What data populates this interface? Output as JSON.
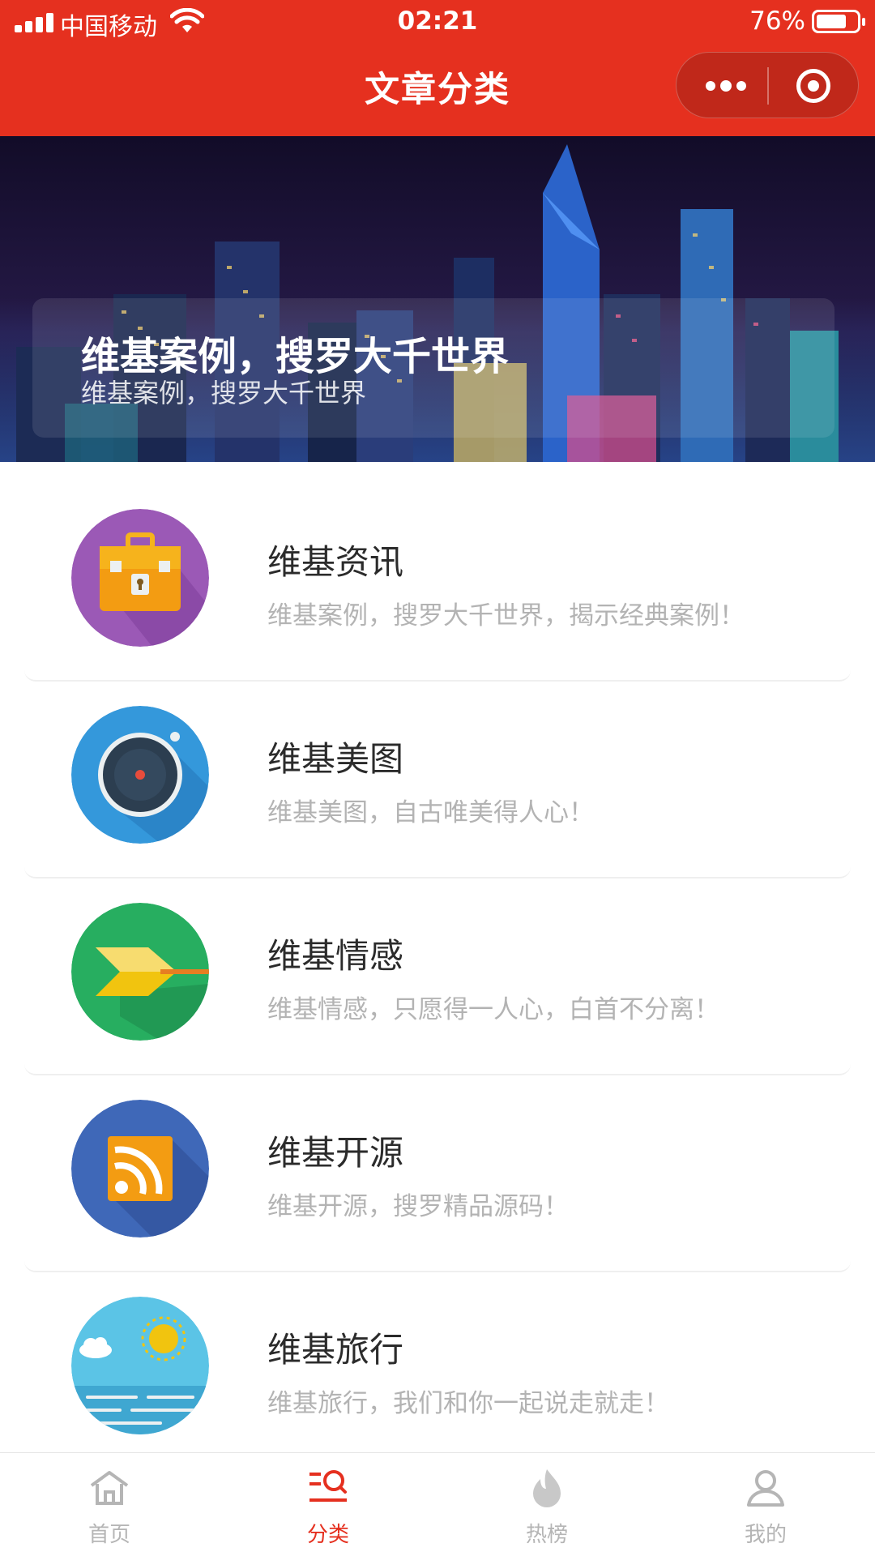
{
  "status_bar": {
    "carrier": "中国移动",
    "time": "02:21",
    "battery_percent": "76%",
    "battery_level": 0.76
  },
  "nav": {
    "title": "文章分类"
  },
  "banner": {
    "title": "维基案例，搜罗大千世界",
    "subtitle": "维基案例，搜罗大千世界"
  },
  "categories": [
    {
      "title": "维基资讯",
      "desc": "维基案例，搜罗大千世界，揭示经典案例！",
      "icon": "briefcase-icon",
      "color": "#9b59b6"
    },
    {
      "title": "维基美图",
      "desc": "维基美图，自古唯美得人心！",
      "icon": "camera-lens-icon",
      "color": "#3498db"
    },
    {
      "title": "维基情感",
      "desc": "维基情感，只愿得一人心，白首不分离！",
      "icon": "arrow-icon",
      "color": "#27ae60"
    },
    {
      "title": "维基开源",
      "desc": "维基开源，搜罗精品源码！",
      "icon": "rss-icon",
      "color": "#3f68b8"
    },
    {
      "title": "维基旅行",
      "desc": "维基旅行，我们和你一起说走就走！",
      "icon": "sun-sea-icon",
      "color": "#5bc4e6"
    }
  ],
  "tabbar": {
    "items": [
      {
        "label": "首页",
        "icon": "home-icon"
      },
      {
        "label": "分类",
        "icon": "category-icon",
        "active": true
      },
      {
        "label": "热榜",
        "icon": "flame-icon"
      },
      {
        "label": "我的",
        "icon": "user-icon"
      }
    ]
  },
  "colors": {
    "brand": "#e5301f",
    "tab_inactive": "#b5b5b5"
  }
}
